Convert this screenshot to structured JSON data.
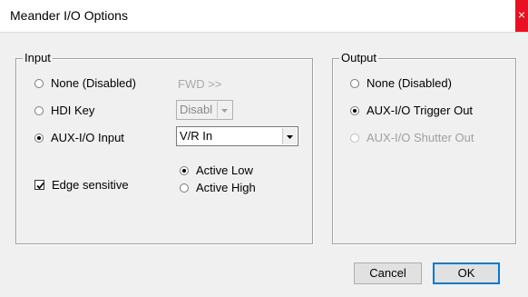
{
  "window": {
    "title": "Meander I/O Options",
    "close_glyph": "×"
  },
  "input": {
    "legend": "Input",
    "options": [
      {
        "label": "None (Disabled)",
        "selected": false
      },
      {
        "label": "HDI Key",
        "selected": false
      },
      {
        "label": "AUX-I/O Input",
        "selected": true
      }
    ],
    "fwd_label": "FWD >>",
    "hdi_select_value": "Disabl",
    "aux_select_value": "V/R In",
    "edge_sensitive": {
      "label": "Edge sensitive",
      "checked": true
    },
    "polarity": [
      {
        "label": "Active Low",
        "selected": true
      },
      {
        "label": "Active High",
        "selected": false
      }
    ]
  },
  "output": {
    "legend": "Output",
    "options": [
      {
        "label": "None (Disabled)",
        "selected": false,
        "enabled": true
      },
      {
        "label": "AUX-I/O Trigger Out",
        "selected": true,
        "enabled": true
      },
      {
        "label": "AUX-I/O Shutter Out",
        "selected": false,
        "enabled": false
      }
    ]
  },
  "buttons": {
    "cancel": "Cancel",
    "ok": "OK"
  }
}
